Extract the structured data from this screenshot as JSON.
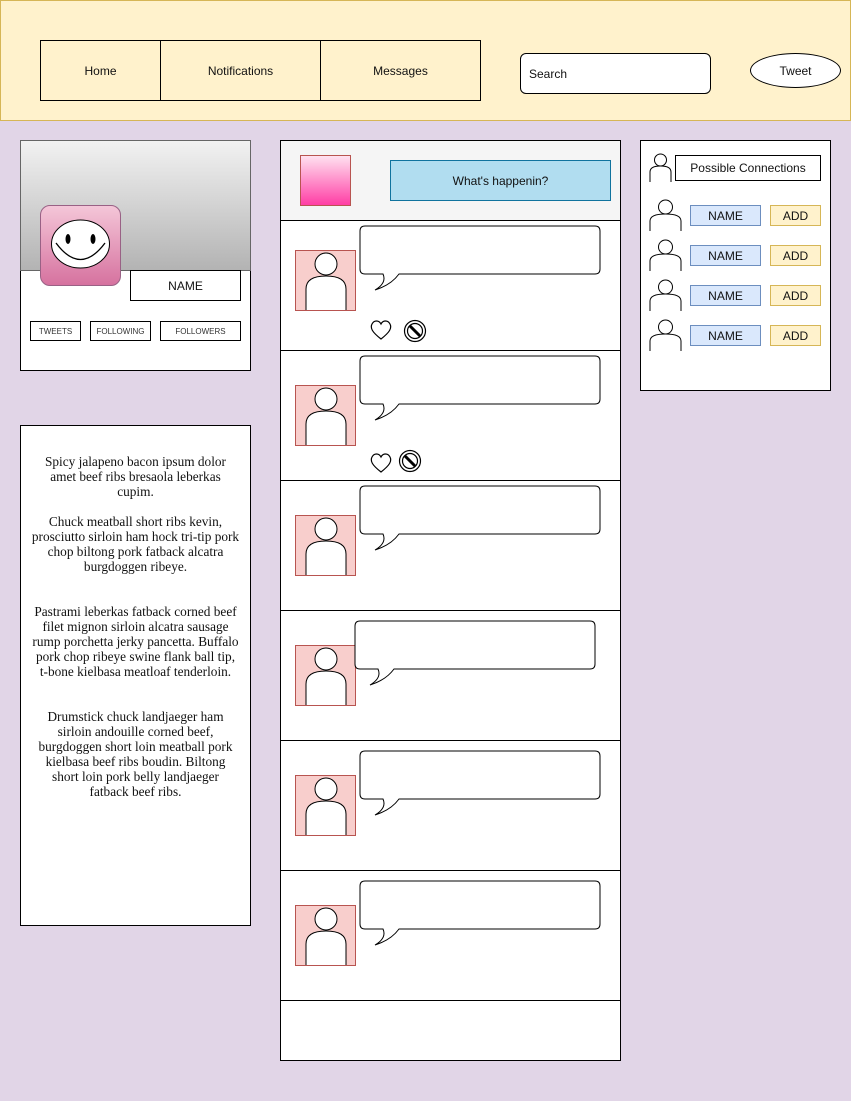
{
  "header": {
    "nav": [
      "Home",
      "Notifications",
      "Messages"
    ],
    "search_placeholder": "Search",
    "tweet_label": "Tweet"
  },
  "profile": {
    "name": "NAME",
    "stats": [
      "TWEETS",
      "FOLLOWING",
      "FOLLOWERS"
    ]
  },
  "bio": [
    "Spicy jalapeno bacon ipsum dolor amet beef ribs bresaola leberkas cupim.",
    "Chuck meatball short ribs kevin, prosciutto sirloin ham hock tri-tip pork chop biltong pork fatback alcatra burgdoggen ribeye.",
    "Pastrami leberkas fatback corned beef filet mignon sirloin alcatra sausage rump porchetta jerky pancetta. Buffalo pork chop ribeye swine flank ball tip, t-bone kielbasa meatloaf tenderloin.",
    "Drumstick chuck landjaeger ham sirloin andouille corned beef, burgdoggen short loin meatball pork kielbasa beef ribs boudin. Biltong short loin pork belly landjaeger fatback beef ribs."
  ],
  "composer": {
    "prompt": "What's happenin?"
  },
  "connections": {
    "title": "Possible Connections",
    "items": [
      {
        "name": "NAME",
        "action": "ADD"
      },
      {
        "name": "NAME",
        "action": "ADD"
      },
      {
        "name": "NAME",
        "action": "ADD"
      },
      {
        "name": "NAME",
        "action": "ADD"
      }
    ]
  },
  "colors": {
    "header_bg": "#fff2cc",
    "page_bg": "#e1d5e7",
    "compose_bg": "#b1ddf0",
    "avatar_bg": "#f8cecc",
    "name_chip": "#dae8fc",
    "add_chip": "#fff2cc"
  }
}
